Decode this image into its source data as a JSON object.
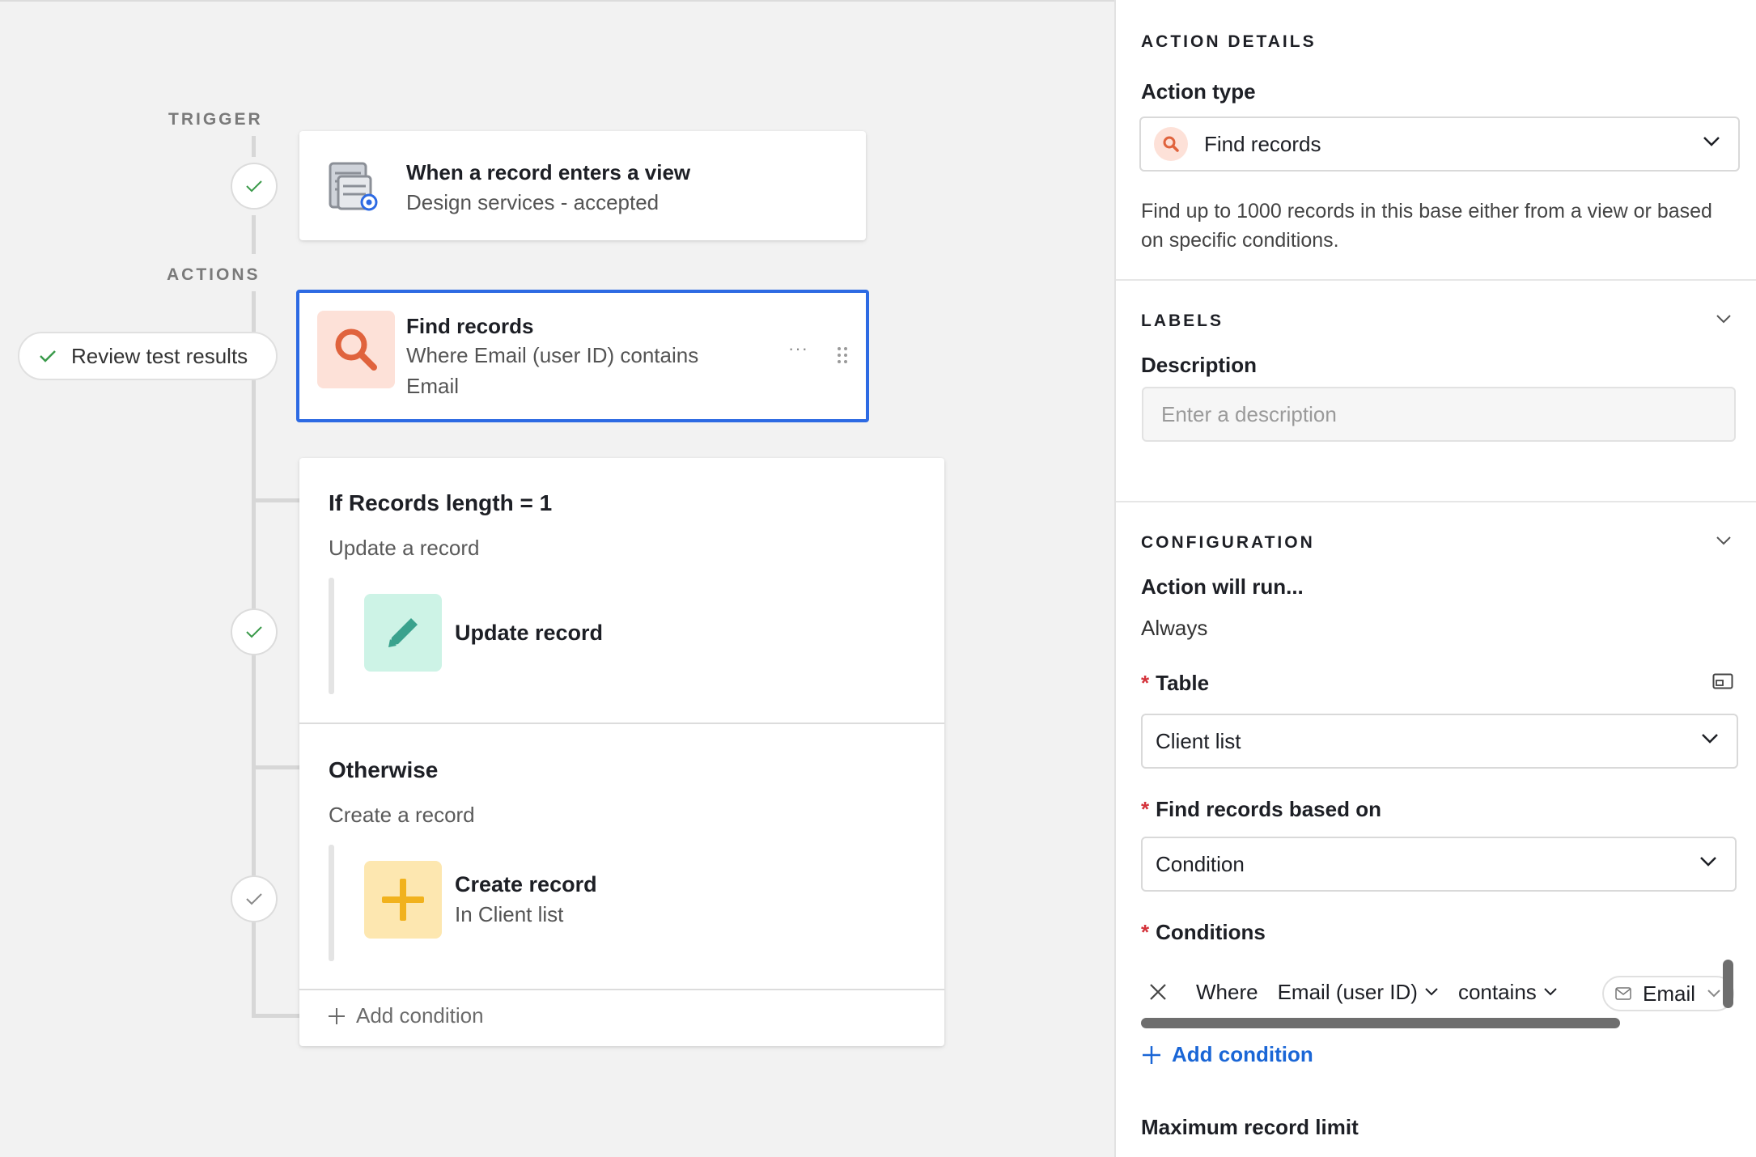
{
  "canvas": {
    "trigger_label": "TRIGGER",
    "actions_label": "ACTIONS",
    "trigger_card": {
      "title": "When a record enters a view",
      "subtitle": "Design services - accepted",
      "icon": "table-view-icon"
    },
    "find_card": {
      "title": "Find records",
      "subtitle": "Where Email (user ID) contains Email",
      "more_label": "···",
      "icon": "search-icon",
      "selected_border_color": "#2d6ae3"
    },
    "review_button": {
      "label": "Review test results"
    },
    "branches": {
      "if": {
        "title": "If Records length = 1",
        "subtitle": "Update a record",
        "action_title": "Update record",
        "icon": "pencil-icon"
      },
      "otherwise": {
        "title": "Otherwise",
        "subtitle": "Create a record",
        "action_title": "Create record",
        "action_subtitle": "In Client list",
        "icon": "plus-icon"
      },
      "add_condition_label": "Add condition"
    }
  },
  "panel": {
    "header": "ACTION DETAILS",
    "action_type": {
      "label": "Action type",
      "value": "Find records",
      "description": "Find up to 1000 records in this base either from a view or based on specific conditions."
    },
    "labels": {
      "header": "LABELS",
      "description_label": "Description",
      "description_placeholder": "Enter a description"
    },
    "configuration": {
      "header": "CONFIGURATION",
      "run_label": "Action will run...",
      "run_value": "Always",
      "table_label": "Table",
      "table_value": "Client list",
      "find_based_label": "Find records based on",
      "find_based_value": "Condition",
      "conditions_label": "Conditions",
      "condition": {
        "prefix": "Where",
        "field": "Email (user ID)",
        "operator": "contains",
        "value": "Email"
      },
      "add_condition_label": "Add condition",
      "max_limit_label": "Maximum record limit"
    }
  },
  "colors": {
    "accent_blue": "#1a66d6",
    "check_green": "#3a9a4a",
    "find_tile_bg": "#fde1d8",
    "find_icon": "#e0633d",
    "update_tile_bg": "#cdf3e6",
    "update_icon": "#3aa28d",
    "create_tile_bg": "#fde7b0",
    "create_icon": "#f1b21d",
    "required_red": "#d4333b"
  }
}
